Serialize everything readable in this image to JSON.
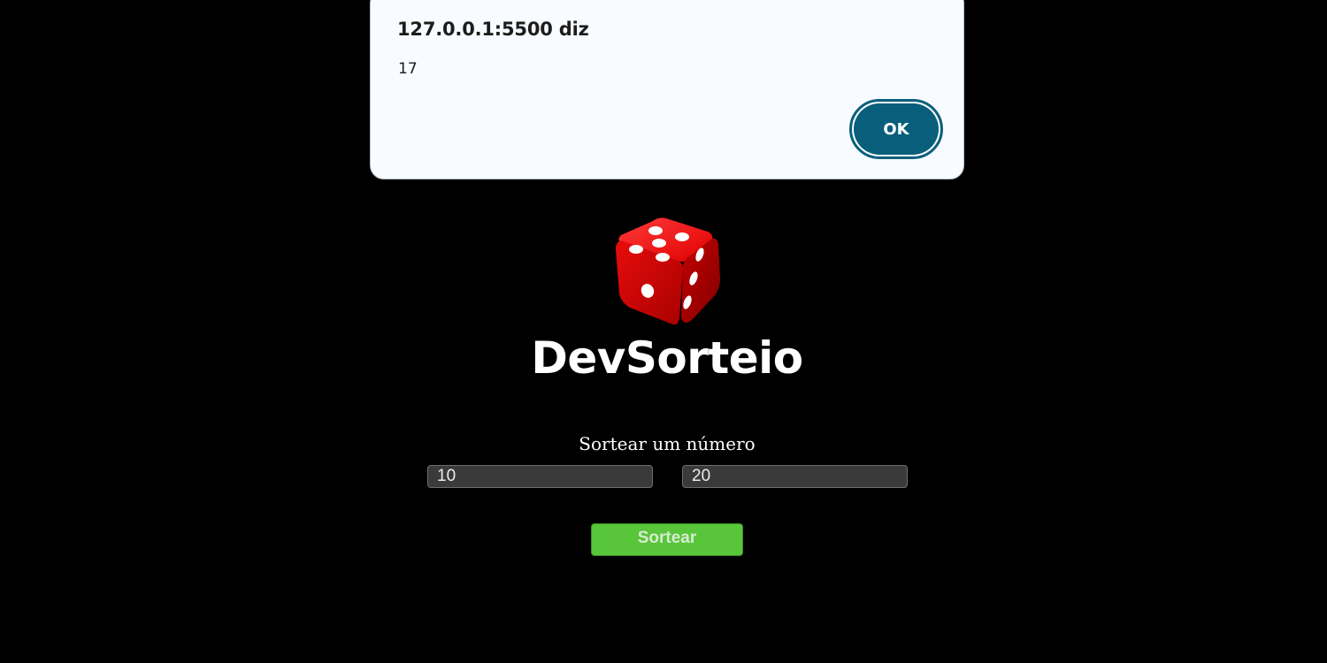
{
  "alert": {
    "title": "127.0.0.1:5500 diz",
    "message": "17",
    "ok_label": "OK",
    "ok_color": "#095e7b"
  },
  "logo": {
    "icon": "red-dice-icon",
    "brand_name": "DevSorteio"
  },
  "form": {
    "label": "Sortear um número",
    "min_value": "10",
    "max_value": "20",
    "button_label": "Sortear",
    "button_color": "#58c53a"
  },
  "page": {
    "background": "#000000"
  }
}
